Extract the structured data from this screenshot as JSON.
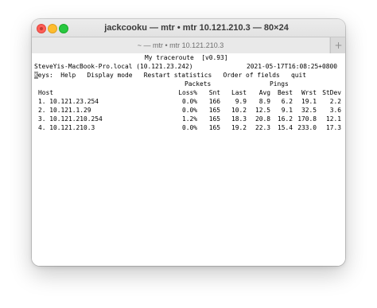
{
  "window": {
    "title": "jackcooku — mtr • mtr 10.121.210.3 — 80×24",
    "title_icon": "folder-icon",
    "tab_label": "~ — mtr • mtr 10.121.210.3",
    "new_tab": "+"
  },
  "mtr": {
    "header": "My traceroute  [v0.93]",
    "host_info": "SteveYis-MacBook-Pro.local (10.121.23.242)",
    "timestamp": "2021-05-17T16:08:25+0800",
    "keys_prefix": "K",
    "keys_rest": "eys:  Help   Display mode   Restart statistics   Order of fields   quit",
    "packets_label": "Packets",
    "pings_label": "Pings",
    "columns": [
      "Host",
      "Loss%",
      "Snt",
      "Last",
      "Avg",
      "Best",
      "Wrst",
      "StDev"
    ],
    "rows": [
      {
        "host": "1. 10.121.23.254",
        "loss": "0.0%",
        "snt": "166",
        "last": "9.9",
        "avg": "8.9",
        "best": "6.2",
        "wrst": "19.1",
        "stdev": "2.2"
      },
      {
        "host": "2. 10.121.1.29",
        "loss": "0.0%",
        "snt": "165",
        "last": "10.2",
        "avg": "12.5",
        "best": "9.1",
        "wrst": "32.5",
        "stdev": "3.6"
      },
      {
        "host": "3. 10.121.210.254",
        "loss": "1.2%",
        "snt": "165",
        "last": "18.3",
        "avg": "20.8",
        "best": "16.2",
        "wrst": "170.8",
        "stdev": "12.1"
      },
      {
        "host": "4. 10.121.210.3",
        "loss": "0.0%",
        "snt": "165",
        "last": "19.2",
        "avg": "22.3",
        "best": "15.4",
        "wrst": "233.0",
        "stdev": "17.3"
      }
    ]
  }
}
